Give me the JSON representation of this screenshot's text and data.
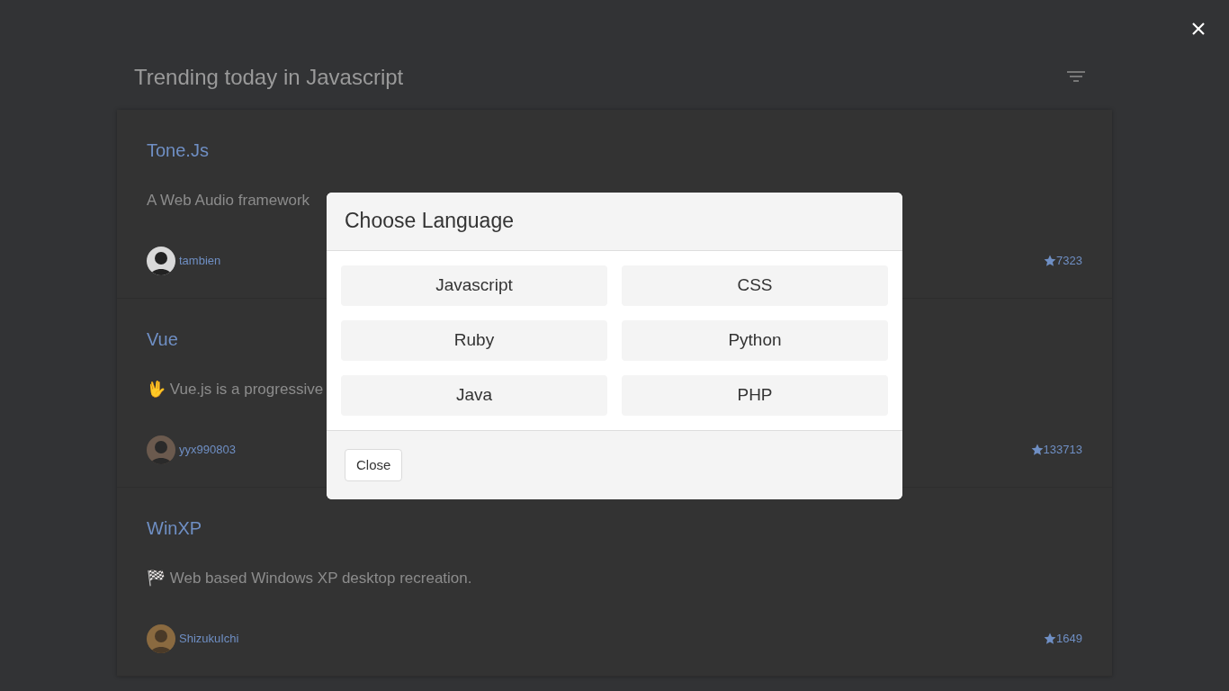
{
  "page": {
    "title": "Trending today in Javascript"
  },
  "repos": [
    {
      "name": "Tone.Js",
      "description": "A Web Audio framework",
      "author": "tambien",
      "stars": "7323"
    },
    {
      "name": "Vue",
      "description": "🖖 Vue.js is a progressive",
      "author": "yyx990803",
      "stars": "133713"
    },
    {
      "name": "WinXP",
      "description": "🏁 Web based Windows XP desktop recreation.",
      "author": "ShizukuIchi",
      "stars": "1649"
    }
  ],
  "modal": {
    "title": "Choose Language",
    "languages": [
      "Javascript",
      "CSS",
      "Ruby",
      "Python",
      "Java",
      "PHP"
    ],
    "close_button": "Close"
  }
}
